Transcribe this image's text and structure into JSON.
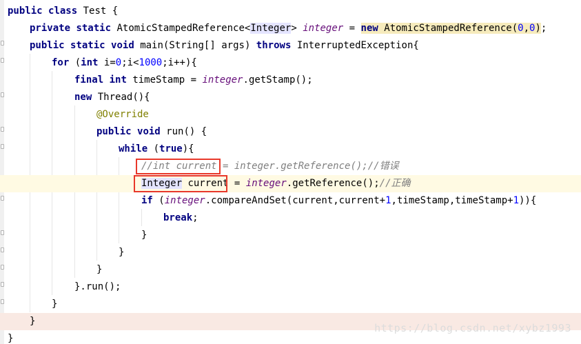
{
  "editor": {
    "language": "Java",
    "caret_line": 11,
    "watermark": "https://blog.csdn.net/xybz1993",
    "lines": [
      "public class Test {",
      "    private static AtomicStampedReference<Integer> integer = new AtomicStampedReference(0,0);",
      "    public static void main(String[] args) throws InterruptedException{",
      "        for (int i=0;i<1000;i++){",
      "            final int timeStamp = integer.getStamp();",
      "            new Thread(){",
      "                @Override",
      "                public void run() {",
      "                    while (true){",
      "                        //int current = integer.getReference();//错误",
      "                        Integer current = integer.getReference();//正确",
      "                        if (integer.compareAndSet(current,current+1,timeStamp,timeStamp+1)){",
      "                            break;",
      "                        }",
      "                    }",
      "                }",
      "            }.run();",
      "        }",
      "    }",
      "}"
    ],
    "tokens": {
      "kw_public": "public",
      "kw_class": "class",
      "kw_private": "private",
      "kw_static": "static",
      "kw_new": "new",
      "kw_void": "void",
      "kw_throws": "throws",
      "kw_for": "for",
      "kw_int": "int",
      "kw_final": "final",
      "kw_while": "while",
      "kw_true": "true",
      "kw_if": "if",
      "kw_break": "break",
      "class_name": "Test",
      "type_asr": "AtomicStampedReference",
      "type_integer": "Integer",
      "type_string": "String",
      "type_exc": "InterruptedException",
      "type_thread": "Thread",
      "field_integer": "integer",
      "var_i": "i",
      "var_args": "args",
      "var_timestamp": "timeStamp",
      "var_current": "current",
      "method_main": "main",
      "method_getstamp": "getStamp",
      "method_run": "run",
      "method_getref": "getReference",
      "method_cas": "compareAndSet",
      "annotation": "@Override",
      "num_0": "0",
      "num_1": "1",
      "num_1000": "1000",
      "comment_wrong": "//int current = integer.getReference();//错误",
      "comment_wrong_head": "//int current",
      "comment_wrong_tail": " = integer.getReference();//错误",
      "comment_right": "//正确"
    },
    "colors": {
      "keyword": "#000080",
      "number": "#0000ff",
      "field": "#660e7a",
      "comment": "#808080",
      "annotation": "#808000",
      "caret_line_bg": "#fffae3",
      "brace_line_bg": "#f9e9e3",
      "type_highlight": "#e4e4ff",
      "new_highlight": "#f6ebbc",
      "annotation_box": "#e8382a"
    }
  }
}
